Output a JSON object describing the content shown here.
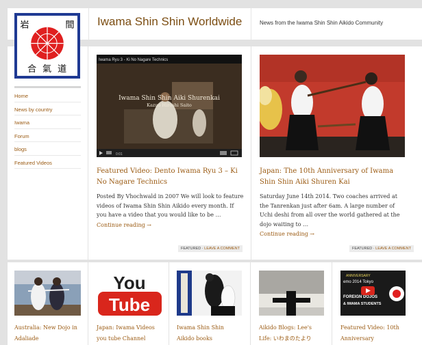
{
  "header": {
    "site_title": "Iwama Shin Shin Worldwide",
    "tagline": "News from the Iwama Shin Shin Aikido Community"
  },
  "logo": {
    "kanji": [
      "岩",
      "間",
      "合",
      "氣",
      "道"
    ],
    "colors": {
      "frame": "#1f3a93",
      "sun": "#e02020"
    }
  },
  "sidebar": {
    "items": [
      {
        "label": "Home"
      },
      {
        "label": "News by country"
      },
      {
        "label": "Iwama"
      },
      {
        "label": "Forum"
      },
      {
        "label": "blogs"
      },
      {
        "label": "Featured Videos"
      }
    ]
  },
  "featured": [
    {
      "video_title": "Iwama Ryu 3 - Ki No Nagare Technics",
      "overlay_title": "Iwama Shin Shin Aiki Shurenkai",
      "overlay_sub": "Kazuo Hiroshi Saito",
      "time": "0:01",
      "title": "Featured Video: Dento Iwama Ryu 3 – Ki No Nagare Technics",
      "excerpt": "Posted By Vhochwald in 2007 We will look to feature videos of Iwama Shin Shin Aikido every month. If you have a video that you would like to be …",
      "more": "Continue reading →",
      "tag": "FEATURED",
      "comment": "LEAVE A COMMENT"
    },
    {
      "title": "Japan: The 10th Anniversary of Iwama Shin Shin Aiki Shuren Kai",
      "excerpt": "Saturday June 14th 2014. Two coaches arrived at the Tanrenkan just after 6am. A large number of Uchi deshi from all over the world gathered at the dojo waiting to …",
      "more": "Continue reading →",
      "tag": "FEATURED",
      "comment": "LEAVE A COMMENT"
    }
  ],
  "row2": [
    {
      "title_lines": [
        "Australia: New Dojo in",
        "Adaliade"
      ]
    },
    {
      "title_lines": [
        "Japan: Iwama Videos",
        "you tube Channel"
      ],
      "thumb_text": [
        "You",
        "Tube"
      ]
    },
    {
      "title_lines": [
        "Iwama Shin Shin",
        "Aikido books"
      ]
    },
    {
      "title_lines": [
        "Aikido Blogs: Lee's",
        "Life: いわまのたより"
      ]
    },
    {
      "title_lines": [
        "Featured Video: 10th",
        "Anniversary"
      ],
      "thumb_text": [
        "ANNIVERSARY",
        "emo 2014 Tokyo",
        "FOREIGN DOJOS",
        "& IWAMA STUDENTS"
      ]
    }
  ]
}
